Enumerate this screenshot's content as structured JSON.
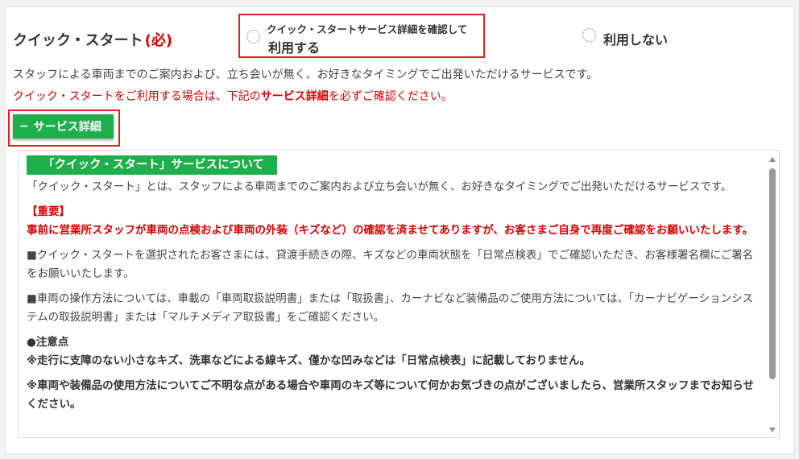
{
  "form": {
    "title": "クイック・スタート",
    "required_mark": "(必)",
    "option_use": {
      "small_label": "クイック・スタートサービス詳細を確認して",
      "label": "利用する"
    },
    "option_not_use": {
      "label": "利用しない"
    },
    "description": "スタッフによる車両までのご案内および、立ち会いが無く、お好きなタイミングでご出発いただけるサービスです。",
    "notice_pre": "クイック・スタートをご利用する場合は、下記の",
    "notice_bold": "サービス詳細",
    "notice_post": "を必ずご確認ください。",
    "detail_button": {
      "icon": "−",
      "label": "サービス詳細"
    }
  },
  "details": {
    "heading": "「クイック・スタート」サービスについて",
    "intro": "「クイック・スタート」とは、スタッフによる車両までのご案内および立ち会いが無く、お好きなタイミングでご出発いただけるサービスです。",
    "important_label": "【重要】",
    "important_text": "事前に営業所スタッフが車両の点検および車両の外装（キズなど）の確認を済ませてありますが、お客さまご自身で再度ご確認をお願いいたします。",
    "para1": "■クイック・スタートを選択されたお客さまには、貸渡手続きの際、キズなどの車両状態を「日常点検表」でご確認いただき、お客様署名欄にご署名をお願いいたします。",
    "para2": "■車両の操作方法については、車載の「車両取扱説明書」または「取扱書」、カーナビなど装備品のご使用方法については、「カーナビゲーションシステムの取扱説明書」または「マルチメディア取扱書」をご確認ください。",
    "caution_title": "●注意点",
    "caution1": "※走行に支障のない小さなキズ、洗車などによる線キズ、僅かな凹みなどは「日常点検表」に記載しておりません。",
    "caution2": "※車両や装備品の使用方法についてご不明な点がある場合や車両のキズ等について何かお気づきの点がございましたら、営業所スタッフまでお知らせください。"
  },
  "colors": {
    "accent_green": "#1fae4c",
    "alert_red": "#d60000",
    "highlight_border": "#e01e1e"
  }
}
